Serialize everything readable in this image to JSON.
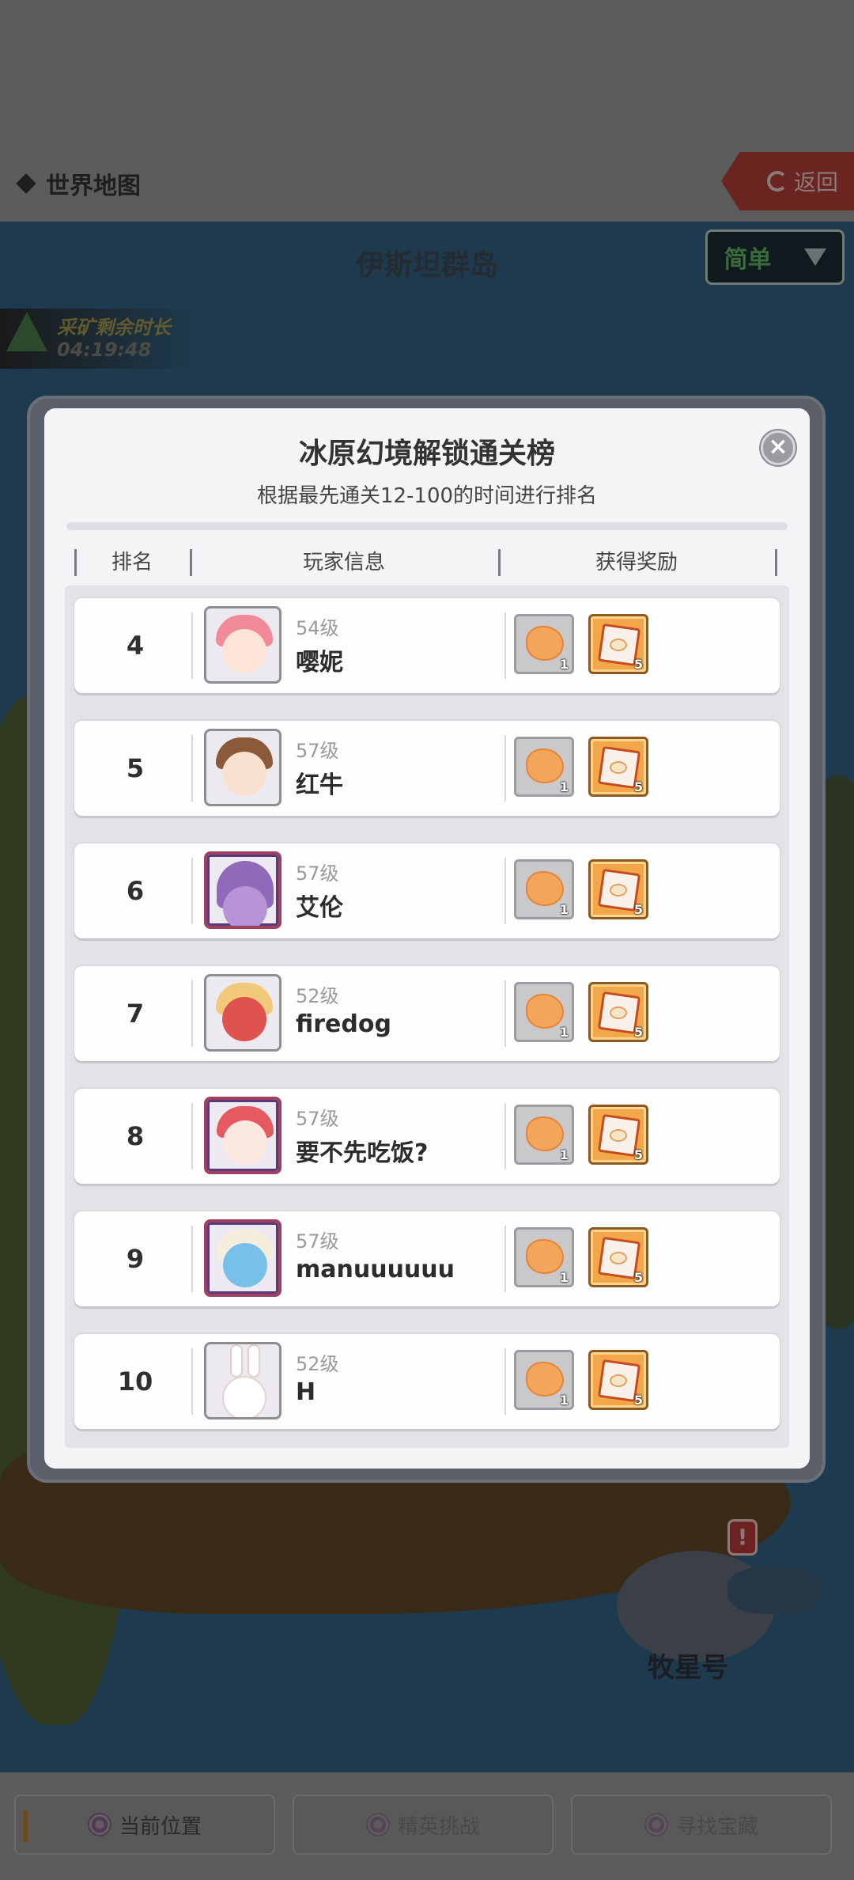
{
  "topbar": {
    "world_map": "世界地图",
    "back": "返回"
  },
  "scene": {
    "region_title": "伊斯坦群岛",
    "difficulty": "简单",
    "mining_label": "采矿剩余时长",
    "mining_time": "04:19:48",
    "ship_name": "牧星号",
    "ship_alert": "!"
  },
  "modal": {
    "title": "冰原幻境解锁通关榜",
    "subtitle": "根据最先通关12-100的时间进行排名",
    "close": "×",
    "headers": {
      "rank": "排名",
      "player": "玩家信息",
      "reward": "获得奖励"
    },
    "rows": [
      {
        "rank": "4",
        "level": "54级",
        "name": "嘤妮",
        "avatar": "pink-hair-girl-avatar",
        "reward1_count": "1",
        "reward2_count": "5"
      },
      {
        "rank": "5",
        "level": "57级",
        "name": "红牛",
        "avatar": "brown-hair-boy-avatar",
        "reward1_count": "1",
        "reward2_count": "5"
      },
      {
        "rank": "6",
        "level": "57级",
        "name": "艾伦",
        "avatar": "purple-creature-avatar",
        "reward1_count": "1",
        "reward2_count": "5"
      },
      {
        "rank": "7",
        "level": "52级",
        "name": "firedog",
        "avatar": "red-dog-avatar",
        "reward1_count": "1",
        "reward2_count": "5"
      },
      {
        "rank": "8",
        "level": "57级",
        "name": "要不先吃饭?",
        "avatar": "red-hair-girl-avatar",
        "reward1_count": "1",
        "reward2_count": "5"
      },
      {
        "rank": "9",
        "level": "57级",
        "name": "manuuuuuu",
        "avatar": "blue-chef-avatar",
        "reward1_count": "1",
        "reward2_count": "5"
      },
      {
        "rank": "10",
        "level": "52级",
        "name": "H",
        "avatar": "white-rabbit-avatar",
        "reward1_count": "1",
        "reward2_count": "5"
      }
    ]
  },
  "bottom_nav": {
    "current_position": "当前位置",
    "elite_challenge": "精英挑战",
    "find_treasure": "寻找宝藏"
  },
  "colors": {
    "modal_bg": "#f4f4f6",
    "reward_orange": "#f2a84a",
    "overlay": "#5a5a5a"
  }
}
